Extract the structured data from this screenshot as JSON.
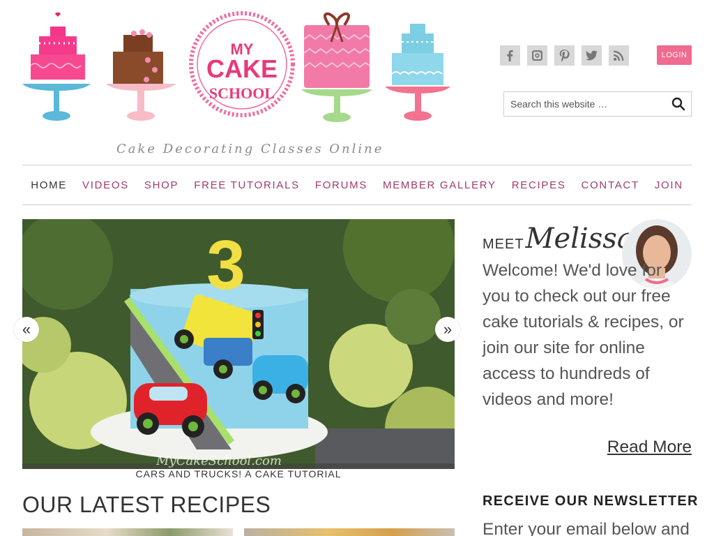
{
  "header": {
    "tagline": "Cake Decorating Classes Online",
    "logo_text": [
      "MY",
      "CAKE",
      "SCHOOL"
    ],
    "login_label": "LOGIN",
    "social_icons": [
      "facebook-icon",
      "instagram-icon",
      "pinterest-icon",
      "twitter-icon",
      "rss-icon"
    ]
  },
  "search": {
    "placeholder": "Search this website …"
  },
  "nav": {
    "items": [
      "HOME",
      "VIDEOS",
      "SHOP",
      "FREE TUTORIALS",
      "FORUMS",
      "MEMBER GALLERY",
      "RECIPES",
      "CONTACT",
      "JOIN"
    ],
    "active": "HOME"
  },
  "slider": {
    "caption": "CARS AND TRUCKS! A CAKE TUTORIAL",
    "prev_label": "«",
    "next_label": "»",
    "watermark": "MyCakeSchool.com",
    "cake_topper": "3"
  },
  "main": {
    "section_title": "OUR LATEST RECIPES"
  },
  "sidebar": {
    "meet_prefix": "MEET",
    "meet_name": "Melissa",
    "welcome_text": "Welcome! We'd love for you to check out our free cake tutorials & recipes, or join our site for online access to hundreds of videos and more!",
    "read_more": "Read More",
    "newsletter_title": "RECEIVE OUR NEWSLETTER",
    "newsletter_text": "Enter your email below and"
  },
  "colors": {
    "nav_link": "#a13b6a",
    "login_bg": "#f06b8f",
    "pink": "#f46da0",
    "blue": "#7ccfe3"
  }
}
